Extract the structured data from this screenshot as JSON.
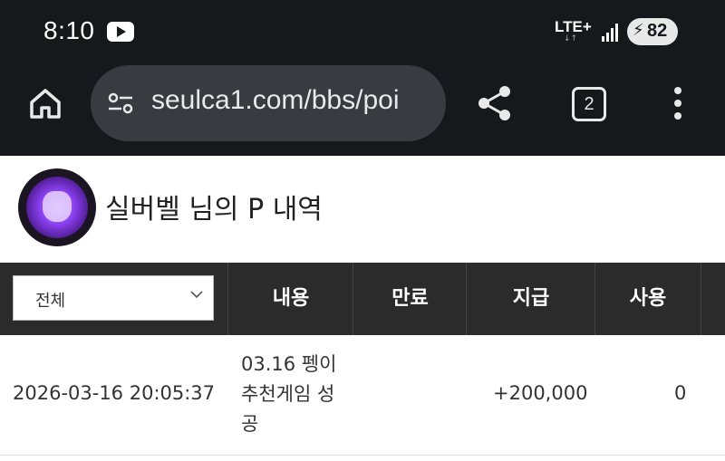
{
  "status_bar": {
    "time": "8:10",
    "network": "LTE+",
    "battery": "82"
  },
  "browser": {
    "url": "seulca1.com/bbs/poi",
    "tab_count": "2"
  },
  "profile": {
    "title": "실버벨 님의 P 내역"
  },
  "table": {
    "filter": {
      "selected": "전체"
    },
    "columns": [
      "내용",
      "만료",
      "지급",
      "사용"
    ],
    "rows": [
      {
        "date": "2026-03-16 20:05:37",
        "content": "03.16 펭이 추천게임 성공",
        "expiry": "",
        "amount": "+200,000",
        "used": "0"
      }
    ]
  },
  "colors": {
    "chrome_bg": "#17181c",
    "omnibox_bg": "#3a3b40",
    "table_header_bg": "#2b2b2b",
    "avatar_accent": "#8a3ff0"
  }
}
